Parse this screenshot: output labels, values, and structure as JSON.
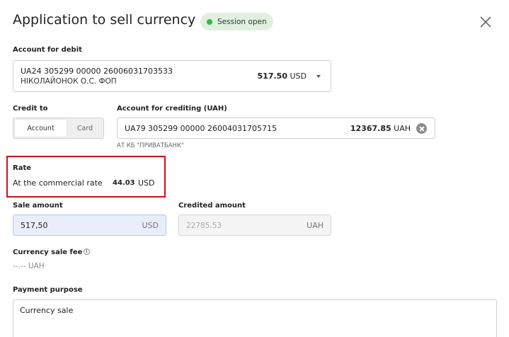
{
  "header": {
    "title": "Application to sell currency",
    "badge": "Session open",
    "badge_color": "#3bb54a",
    "close_icon": "close-icon"
  },
  "debit": {
    "label": "Account for debit",
    "account": "UA24 305299 00000 26006031703533",
    "owner": "НІКОЛАЙОНОК О.С. ФОП",
    "amount": "517.50",
    "currency": "USD"
  },
  "credit_to": {
    "label": "Credit to",
    "options": [
      "Account",
      "Card"
    ],
    "selected": "Account"
  },
  "credit_account": {
    "label": "Account for crediting (UAH)",
    "account": "UA79 305299 00000 26004031705715",
    "amount": "12367.85",
    "currency": "UAH",
    "bank": "АТ КБ \"ПРИВАТБАНК\""
  },
  "rate": {
    "label": "Rate",
    "text": "At the commercial rate",
    "value": "44.03",
    "currency": "USD",
    "highlight_color": "#d0101a"
  },
  "sale_amount": {
    "label": "Sale amount",
    "value": "517,50",
    "currency": "USD"
  },
  "credited_amount": {
    "label": "Credited amount",
    "value": "22785.53",
    "currency": "UAH"
  },
  "fee": {
    "label": "Currency sale fee",
    "value": "--.-- UAH"
  },
  "purpose": {
    "label": "Payment purpose",
    "value": "Currency sale"
  }
}
